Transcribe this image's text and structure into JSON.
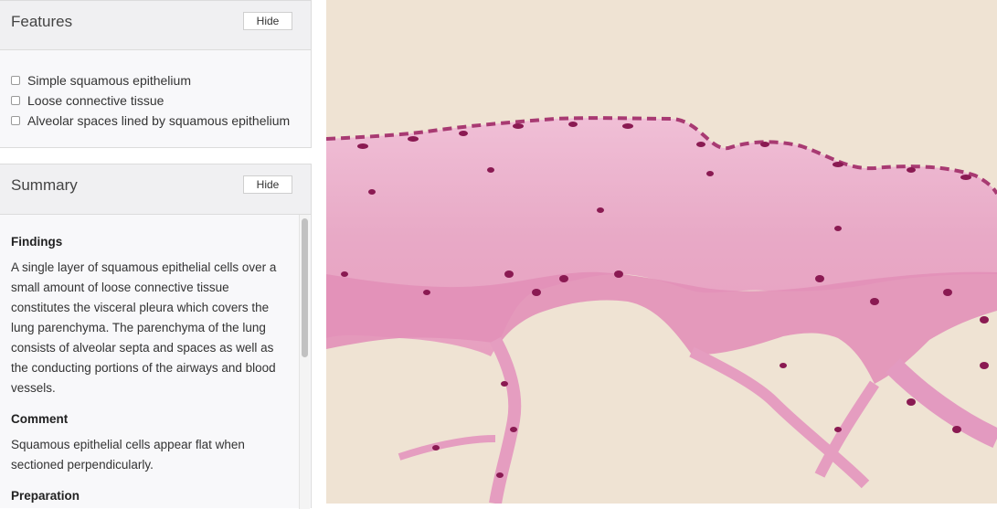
{
  "features": {
    "title": "Features",
    "hide_label": "Hide",
    "items": [
      "Simple squamous epithelium",
      "Loose connective tissue",
      "Alveolar spaces lined by squamous epithelium"
    ]
  },
  "summary": {
    "title": "Summary",
    "hide_label": "Hide",
    "findings_heading": "Findings",
    "findings_text": "A single layer of squamous epithelial cells over a small amount of loose connective tissue constitutes the visceral pleura which covers the lung parenchyma. The parenchyma of the lung consists of alveolar septa and spaces as well as the conducting portions of the airways and blood vessels.",
    "comment_heading": "Comment",
    "comment_text": "Squamous epithelial cells appear flat when sectioned perpendicularly.",
    "preparation_heading": "Preparation"
  },
  "colors": {
    "background": "#efe3d3",
    "tissue_pink": "#e7a6c4",
    "nuclei": "#8a1a52"
  }
}
